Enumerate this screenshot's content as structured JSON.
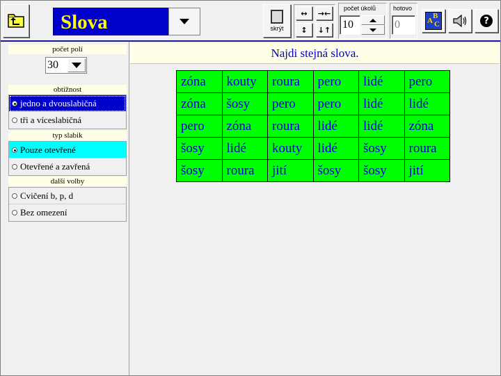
{
  "app": {
    "title": "Slova"
  },
  "toolbar": {
    "hide_label": "skrýt",
    "task_count_label": "počet úkolů",
    "task_count_value": "10",
    "done_label": "hotovo",
    "done_value": "0",
    "abc_letters": [
      "A",
      "B",
      "C"
    ],
    "help_glyph": "?",
    "arrows": [
      "↔",
      "→←",
      "↕",
      "↓↑"
    ]
  },
  "left": {
    "field_count_header": "počet polí",
    "field_count_value": "30",
    "difficulty_header": "obtížnost",
    "difficulty_options": [
      "jedno a dvouslabičná",
      "tři a víceslabičná"
    ],
    "syllable_header": "typ slabik",
    "syllable_options": [
      "Pouze otevřené",
      "Otevřené a zavřená"
    ],
    "other_header": "další volby",
    "other_options": [
      "Cvičení b, p, d",
      "Bez omezení"
    ]
  },
  "main": {
    "instruction": "Najdi stejná slova.",
    "grid": [
      [
        "zóna",
        "kouty",
        "roura",
        "pero",
        "lidé",
        "pero"
      ],
      [
        "zóna",
        "šosy",
        "pero",
        "pero",
        "lidé",
        "lidé"
      ],
      [
        "pero",
        "zóna",
        "roura",
        "lidé",
        "lidé",
        "zóna"
      ],
      [
        "šosy",
        "lidé",
        "kouty",
        "lidé",
        "šosy",
        "roura"
      ],
      [
        "šosy",
        "roura",
        "jití",
        "šosy",
        "šosy",
        "jití"
      ]
    ]
  },
  "colors": {
    "title_bg": "#0000cc",
    "title_fg": "#ffff00",
    "cell_bg": "#00ff00",
    "cell_fg": "#0000cc",
    "selected_blue": "#0000cc",
    "selected_cyan": "#00ffff"
  },
  "icons": {
    "folder": "folder-up-icon",
    "dropdown": "chevron-down-icon",
    "hide": "hide-panel-icon",
    "abc": "abc-spelling-icon",
    "speaker": "speaker-icon",
    "help": "help-icon"
  }
}
